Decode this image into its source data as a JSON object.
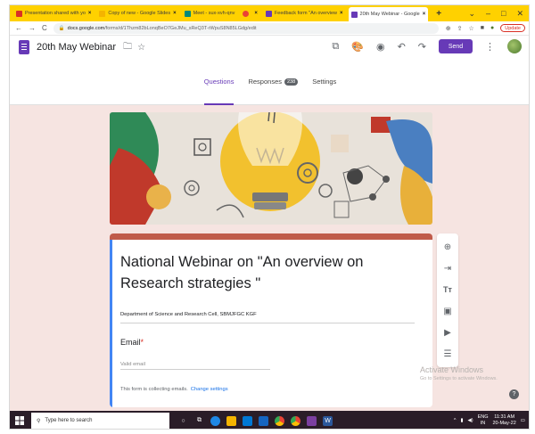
{
  "browser": {
    "tabs": [
      {
        "title": "Presentation shared with yo",
        "favicon_color": "#d93025",
        "active": false
      },
      {
        "title": "Copy of new - Google Slides",
        "favicon_color": "#f4b400",
        "active": false
      },
      {
        "title": "Meet - sux-xvh-qnv",
        "favicon_color": "#00897b",
        "active": false
      },
      {
        "title": "",
        "favicon_color": "#ea4335",
        "active": false
      },
      {
        "title": "Feedback form \"An overview",
        "favicon_color": "#673ab7",
        "active": false
      },
      {
        "title": "20th May Webinar - Google",
        "favicon_color": "#673ab7",
        "active": true
      }
    ],
    "new_tab_label": "+",
    "url_domain": "docs.google.com",
    "url_path": "/forms/d/1Thzm82bLonqBeO7GeJMu_sReQ3T-rWpuS8N85LGdg/edit",
    "update_label": "Update"
  },
  "form_header": {
    "title": "20th May Webinar",
    "send_label": "Send"
  },
  "form_tabs": {
    "questions": "Questions",
    "responses": "Responses",
    "responses_count": "238",
    "settings": "Settings"
  },
  "form": {
    "heading": "National Webinar on \"An overview on Research strategies \"",
    "description": "Department of  Science  and Research Cell, SBMJFGC KGF",
    "email_label": "Email",
    "required_mark": "*",
    "email_placeholder": "Valid email",
    "collecting_note": "This form is collecting emails.",
    "change_settings": "Change settings",
    "accent_color": "#673ab7",
    "theme_color": "#c05b4a"
  },
  "toolbar": [
    "add-question-icon",
    "import-questions-icon",
    "add-title-icon",
    "add-image-icon",
    "add-video-icon",
    "add-section-icon"
  ],
  "watermark": {
    "line1": "Activate Windows",
    "line2": "Go to Settings to activate Windows."
  },
  "help_label": "?",
  "taskbar": {
    "search_placeholder": "Type here to search",
    "time": "11:31 AM",
    "date": "20-May-22",
    "lang": "ENG",
    "region": "IN"
  }
}
